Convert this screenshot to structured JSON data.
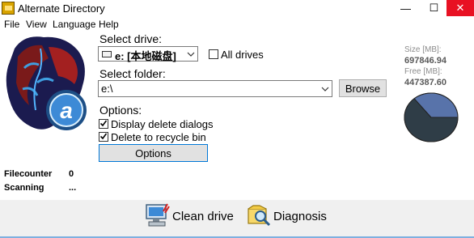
{
  "window": {
    "title": "Alternate Directory",
    "minimize": "—",
    "maximize": "☐",
    "close": "✕"
  },
  "menu": [
    {
      "label": "File"
    },
    {
      "label": "View"
    },
    {
      "label": "Language"
    },
    {
      "label": "Help"
    }
  ],
  "drive": {
    "heading": "Select drive:",
    "selected": "e: [本地磁盘]",
    "all_drives_label": "All drives",
    "all_drives_checked": false
  },
  "folder": {
    "heading": "Select folder:",
    "value": "e:\\",
    "browse_label": "Browse"
  },
  "options": {
    "heading": "Options:",
    "display_delete_dialogs_label": "Display delete dialogs",
    "display_delete_dialogs_checked": true,
    "delete_to_recycle_bin_label": "Delete to recycle bin",
    "delete_to_recycle_bin_checked": true,
    "options_button_label": "Options"
  },
  "stats": {
    "size_label": "Size [MB]:",
    "size_value": "697846.94",
    "free_label": "Free [MB]:",
    "free_value": "447387.60",
    "free_fraction": 0.641,
    "colors": {
      "used": "#5873aa",
      "free": "#2f3d47"
    }
  },
  "status": {
    "filecounter_label": "Filecounter",
    "filecounter_value": "0",
    "scanning_label": "Scanning",
    "scanning_value": "..."
  },
  "actions": {
    "clean_drive_label": "Clean drive",
    "diagnosis_label": "Diagnosis"
  }
}
